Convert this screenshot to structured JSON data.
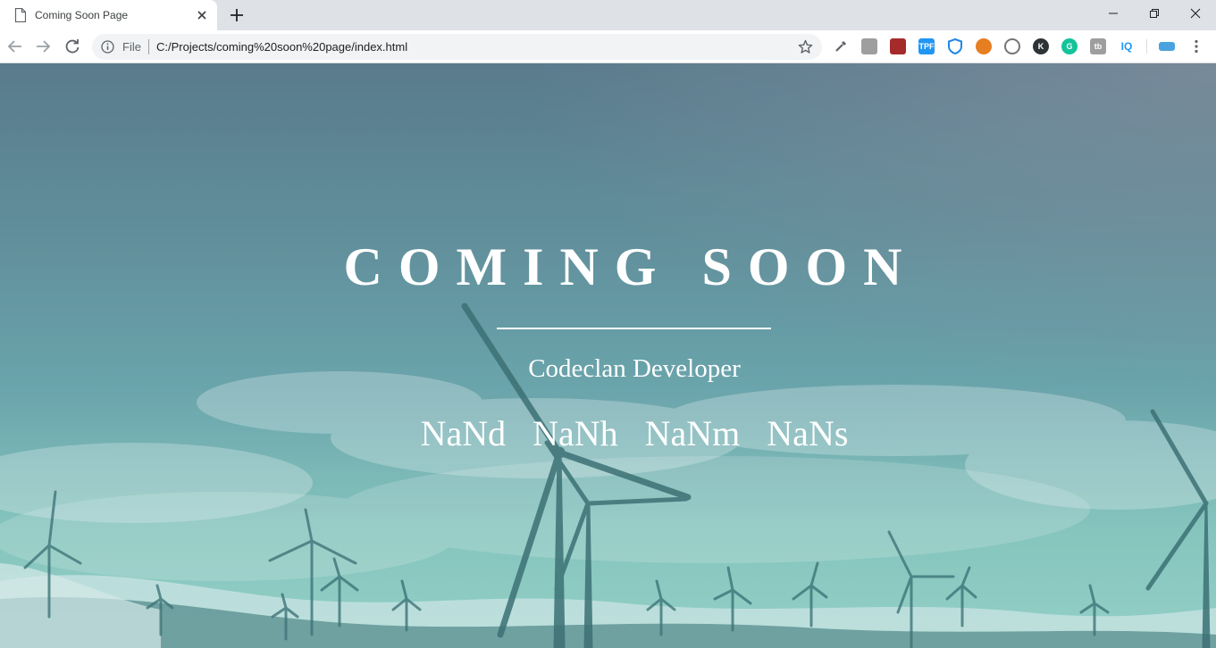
{
  "browser": {
    "tab": {
      "title": "Coming Soon Page"
    },
    "address": {
      "scheme": "File",
      "url": "C:/Projects/coming%20soon%20page/index.html"
    },
    "extensions": [
      {
        "name": "eyedropper-extension-icon",
        "color": "#5f6368",
        "label": ""
      },
      {
        "name": "extension-icon-2",
        "color": "#9e9e9e",
        "label": ""
      },
      {
        "name": "chart-extension-icon",
        "color": "#a52a2a",
        "label": ""
      },
      {
        "name": "tpf-extension-icon",
        "color": "#2196f3",
        "label": "TPF"
      },
      {
        "name": "shield-extension-icon",
        "color": "#1e88e5",
        "label": ""
      },
      {
        "name": "reddit-extension-icon",
        "color": "#e67e22",
        "label": ""
      },
      {
        "name": "circle-extension-icon",
        "color": "#757575",
        "label": ""
      },
      {
        "name": "k-extension-icon",
        "color": "#2d3436",
        "label": "K"
      },
      {
        "name": "grammarly-extension-icon",
        "color": "#15c39a",
        "label": "G"
      },
      {
        "name": "tb-extension-icon",
        "color": "#9e9e9e",
        "label": "tb"
      },
      {
        "name": "iq-extension-icon",
        "color": "#ffffff",
        "label": "IQ"
      },
      {
        "name": "stack-extension-icon",
        "color": "#4aa3df",
        "label": ""
      }
    ]
  },
  "page": {
    "title": "COMING SOON",
    "subtitle": "Codeclan Developer",
    "countdown": {
      "days": "NaNd",
      "hours": "NaNh",
      "minutes": "NaNm",
      "seconds": "NaNs"
    }
  }
}
